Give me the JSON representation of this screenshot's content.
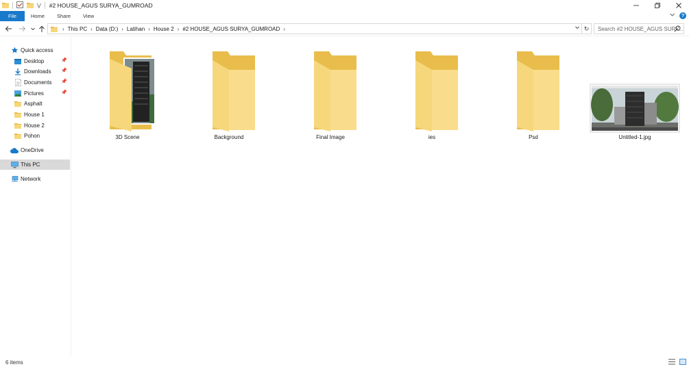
{
  "window": {
    "title": "#2 HOUSE_AGUS SURYA_GUMROAD",
    "controls": [
      "minimize",
      "restore",
      "close"
    ]
  },
  "ribbon": {
    "tabs": [
      {
        "label": "File",
        "active": true
      },
      {
        "label": "Home"
      },
      {
        "label": "Share"
      },
      {
        "label": "View"
      }
    ]
  },
  "address": {
    "breadcrumbs": [
      "This PC",
      "Data (D:)",
      "Latihan",
      "House 2",
      "#2 HOUSE_AGUS SURYA_GUMROAD"
    ],
    "search_placeholder": "Search #2 HOUSE_AGUS SURY..."
  },
  "sidebar": {
    "quick_access": "Quick access",
    "items": [
      {
        "label": "Desktop",
        "icon": "desktop-icon",
        "pinned": true
      },
      {
        "label": "Downloads",
        "icon": "downloads-icon",
        "pinned": true
      },
      {
        "label": "Documents",
        "icon": "documents-icon",
        "pinned": true
      },
      {
        "label": "Pictures",
        "icon": "pictures-icon",
        "pinned": true
      },
      {
        "label": "Asphalt",
        "icon": "folder-icon"
      },
      {
        "label": "House 1",
        "icon": "folder-icon"
      },
      {
        "label": "House 2",
        "icon": "folder-icon"
      },
      {
        "label": "Pohon",
        "icon": "folder-icon"
      }
    ],
    "onedrive": "OneDrive",
    "this_pc": "This PC",
    "network": "Network"
  },
  "files": [
    {
      "name": "3D Scene",
      "type": "folder-with-preview"
    },
    {
      "name": "Background",
      "type": "folder"
    },
    {
      "name": "Final Image",
      "type": "folder"
    },
    {
      "name": "ies",
      "type": "folder"
    },
    {
      "name": "Psd",
      "type": "folder"
    },
    {
      "name": "Untitled-1.jpg",
      "type": "image"
    }
  ],
  "status": {
    "count": "6 items"
  },
  "colors": {
    "accent": "#1979ca",
    "folder": "#f6d77b",
    "folder_dark": "#e9bd4c",
    "selected": "#d9d9d9"
  }
}
